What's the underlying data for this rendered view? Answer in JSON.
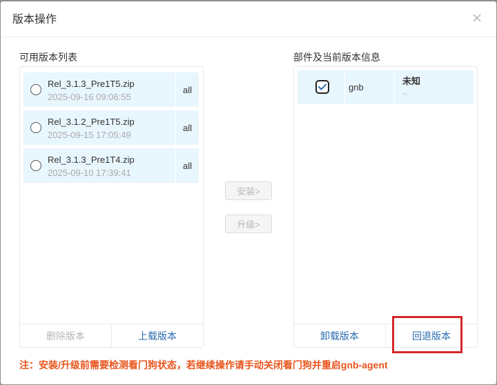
{
  "dialog": {
    "title": "版本操作",
    "close_icon": "close-icon"
  },
  "left_panel": {
    "label": "可用版本列表",
    "versions": [
      {
        "name": "Rel_3.1.3_Pre1T5.zip",
        "time": "2025-09-16 09:06:55",
        "tag": "all",
        "selected": false
      },
      {
        "name": "Rel_3.1.2_Pre1T5.zip",
        "time": "2025-09-15 17:05:49",
        "tag": "all",
        "selected": false
      },
      {
        "name": "Rel_3.1.3_Pre1T4.zip",
        "time": "2025-09-10 17:39:41",
        "tag": "all",
        "selected": false
      }
    ],
    "footer": {
      "delete_label": "删除版本",
      "upload_label": "上载版本"
    }
  },
  "middle": {
    "install_label": "安装>",
    "upgrade_label": "升级>"
  },
  "right_panel": {
    "label": "部件及当前版本信息",
    "components": [
      {
        "name": "gnb",
        "status": "未知",
        "sub": "–",
        "checked": true
      }
    ],
    "footer": {
      "uninstall_label": "卸载版本",
      "rollback_label": "回退版本"
    }
  },
  "warning": "注：安装/升级前需要检测看门狗状态，若继续操作请手动关闭看门狗并重启gnb-agent",
  "colors": {
    "accent": "#2b6cb0",
    "item_bg": "#e8f6fd",
    "warning": "#e8541c",
    "highlight": "#d2282a"
  }
}
